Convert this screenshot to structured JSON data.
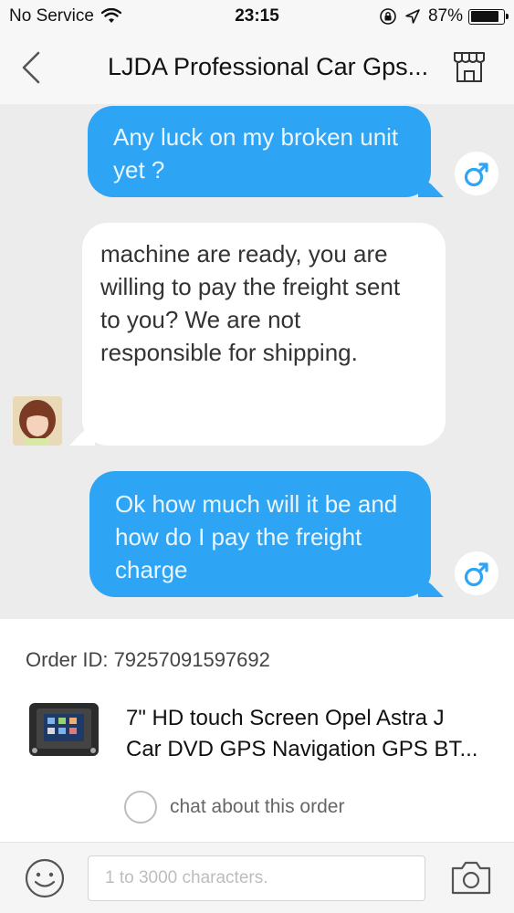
{
  "status_bar": {
    "carrier": "No Service",
    "time": "23:15",
    "battery": "87%",
    "battery_level": 0.87
  },
  "nav": {
    "title": "LJDA Professional Car Gps..."
  },
  "messages": [
    {
      "direction": "outgoing",
      "text": "Any luck on my broken unit\nyet ?"
    },
    {
      "direction": "incoming",
      "text": "machine are ready, you are\nwilling to pay the freight sent\nto you? We are not\nresponsible for shipping."
    },
    {
      "direction": "outgoing",
      "text": "Ok how much will it be and\nhow do I pay the freight\ncharge"
    }
  ],
  "order": {
    "order_id_label": "Order ID: 79257091597692",
    "product_title": "7\" HD touch Screen Opel Astra J\nCar DVD GPS Navigation GPS BT...",
    "chat_about_label": "chat about this order"
  },
  "input": {
    "placeholder": "1 to 3000 characters."
  },
  "colors": {
    "outgoing_bubble": "#2ea4f5",
    "chat_background": "#ececec",
    "male_icon": "#2ea4f5"
  },
  "icons": {
    "back": "chevron-left-icon",
    "store": "store-icon",
    "male": "male-symbol-icon",
    "emoji": "smiley-icon",
    "camera": "camera-icon"
  }
}
